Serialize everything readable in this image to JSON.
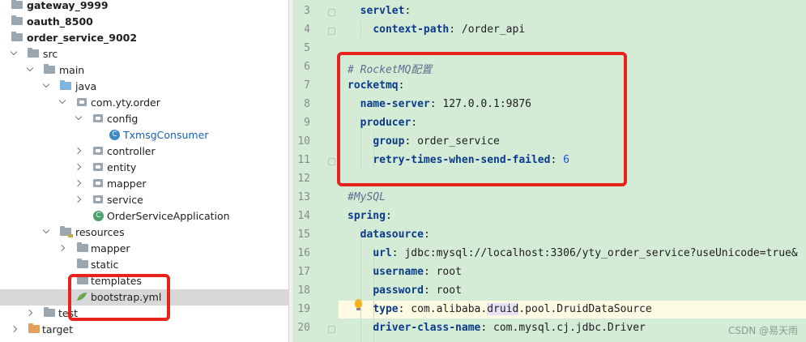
{
  "project_tree": {
    "items": [
      {
        "label": "gateway_9999"
      },
      {
        "label": "oauth_8500"
      },
      {
        "label": "order_service_9002"
      },
      {
        "label": "src"
      },
      {
        "label": "main"
      },
      {
        "label": "java"
      },
      {
        "label": "com.yty.order"
      },
      {
        "label": "config"
      },
      {
        "label": "TxmsgConsumer"
      },
      {
        "label": "controller"
      },
      {
        "label": "entity"
      },
      {
        "label": "mapper"
      },
      {
        "label": "service"
      },
      {
        "label": "OrderServiceApplication"
      },
      {
        "label": "resources"
      },
      {
        "label": "mapper"
      },
      {
        "label": "static"
      },
      {
        "label": "templates"
      },
      {
        "label": "bootstrap.yml"
      },
      {
        "label": "test"
      },
      {
        "label": "target"
      }
    ],
    "selected": "bootstrap.yml"
  },
  "editor": {
    "lines": [
      {
        "num": "3",
        "key": "servlet",
        "value": ""
      },
      {
        "num": "4",
        "key": "context-path",
        "value": " /order_api"
      },
      {
        "num": "5",
        "key": "",
        "value": ""
      },
      {
        "num": "6",
        "comment": "# RocketMQ配置"
      },
      {
        "num": "7",
        "key": "rocketmq",
        "value": ""
      },
      {
        "num": "8",
        "key": "name-server",
        "value": " 127.0.0.1:9876"
      },
      {
        "num": "9",
        "key": "producer",
        "value": ""
      },
      {
        "num": "10",
        "key": "group",
        "value": " order_service"
      },
      {
        "num": "11",
        "key": "retry-times-when-send-failed",
        "value": " 6"
      },
      {
        "num": "12",
        "key": "",
        "value": ""
      },
      {
        "num": "13",
        "comment": "#MySQL"
      },
      {
        "num": "14",
        "key": "spring",
        "value": ""
      },
      {
        "num": "15",
        "key": "datasource",
        "value": ""
      },
      {
        "num": "16",
        "key": "url",
        "value": " jdbc:mysql://localhost:3306/yty_order_service?useUnicode=true&"
      },
      {
        "num": "17",
        "key": "username",
        "value": " root"
      },
      {
        "num": "18",
        "key": "password",
        "value": " root"
      },
      {
        "num": "19",
        "key": "type",
        "value_a": " com.alibaba.",
        "value_b": "druid",
        "value_c": ".pool.DruidDataSource"
      },
      {
        "num": "20",
        "key": "driver-class-name",
        "value": " com.mysql.cj.jdbc.Driver"
      }
    ]
  },
  "watermark": "CSDN @易天雨",
  "colors": {
    "editor_bg": "#d4ecd6",
    "annotation_red": "#e8221c",
    "key_color": "#0b3a8c"
  }
}
